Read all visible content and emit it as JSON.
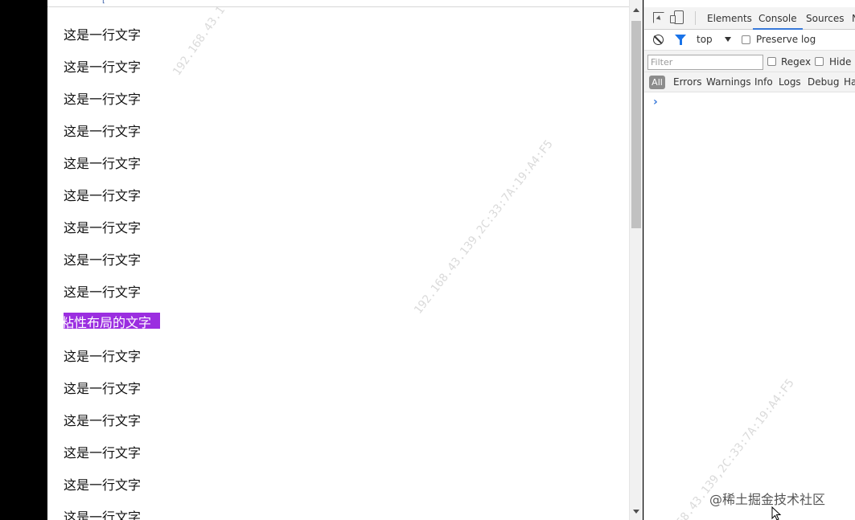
{
  "page": {
    "lines": [
      "这是一行文字",
      "这是一行文字",
      "这是一行文字",
      "这是一行文字",
      "这是一行文字",
      "这是一行文字",
      "这是一行文字",
      "这是一行文字",
      "这是一行文字",
      "这是一行文字",
      "这是一行文字",
      "这是一行文字",
      "这是一行文字",
      "这是一行文字",
      "这是一行文字"
    ],
    "sticky_text": "粘性布局的文字",
    "sticky_color": "#9b2ee0"
  },
  "devtools": {
    "tabs": [
      "Elements",
      "Console",
      "Sources",
      "N"
    ],
    "active_tab": "Console",
    "context": "top",
    "preserve_log_label": "Preserve log",
    "filter_placeholder": "Filter",
    "regex_label": "Regex",
    "hide_label": "Hide n",
    "levels": [
      "All",
      "Errors",
      "Warnings",
      "Info",
      "Logs",
      "Debug",
      "Ha"
    ],
    "prompt": "›",
    "accent_color": "#3879d9"
  },
  "watermark": {
    "text_short": "192.168.43.1",
    "text_full": "192.168.43.139,2C:33:7A:19:A4:F5",
    "text_partial": "68.43.139,2C:33:7A:19:A4:F5"
  },
  "brand": "@稀土掘金技术社区",
  "icons": [
    "inspect-icon",
    "device-toggle-icon",
    "clear-console-icon",
    "filter-icon",
    "dropdown-arrow-icon",
    "mouse-cursor-icon"
  ]
}
